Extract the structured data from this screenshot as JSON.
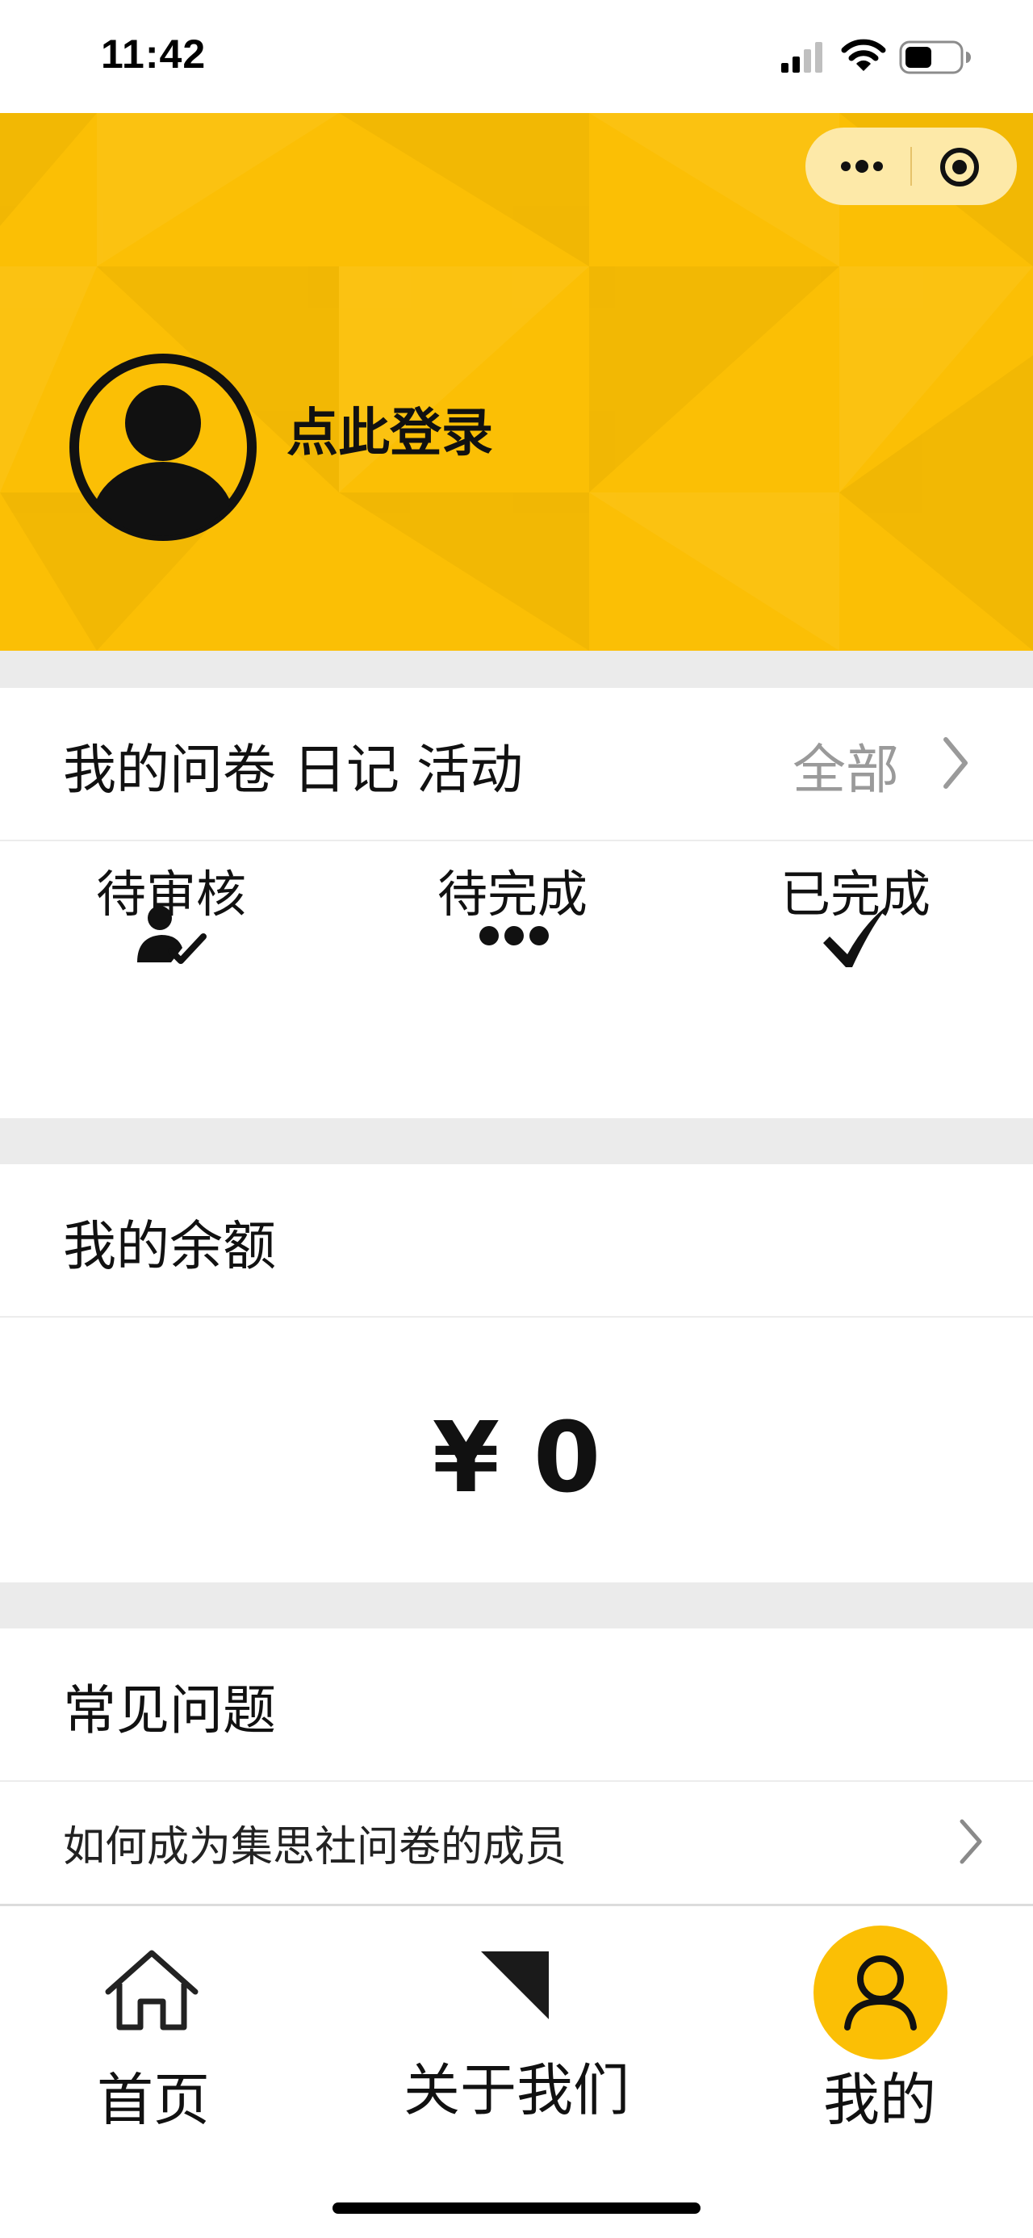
{
  "status_bar": {
    "time": "11:42"
  },
  "header": {
    "login_text": "点此登录",
    "capsule": {
      "more_icon": "more-dots-icon",
      "close_icon": "target-circle-icon"
    },
    "avatar_icon": "user-avatar-icon",
    "colors": {
      "primary": "#fbbf05",
      "capsule": "#fde9a8"
    }
  },
  "my_items": {
    "title": "我的问卷 日记 活动",
    "all_label": "全部",
    "statuses": [
      {
        "label": "待审核",
        "icon": "user-check-icon"
      },
      {
        "label": "待完成",
        "icon": "dots-icon"
      },
      {
        "label": "已完成",
        "icon": "checkmark-icon"
      }
    ]
  },
  "balance": {
    "title": "我的余额",
    "amount": "¥ 0"
  },
  "faq": {
    "title": "常见问题",
    "items": [
      {
        "label": "如何成为集思社问卷的成员"
      }
    ]
  },
  "tabbar": {
    "tabs": [
      {
        "label": "首页",
        "icon": "home-icon",
        "active": false
      },
      {
        "label": "关于我们",
        "icon": "triangle-icon",
        "active": false
      },
      {
        "label": "我的",
        "icon": "user-icon",
        "active": true
      }
    ]
  }
}
